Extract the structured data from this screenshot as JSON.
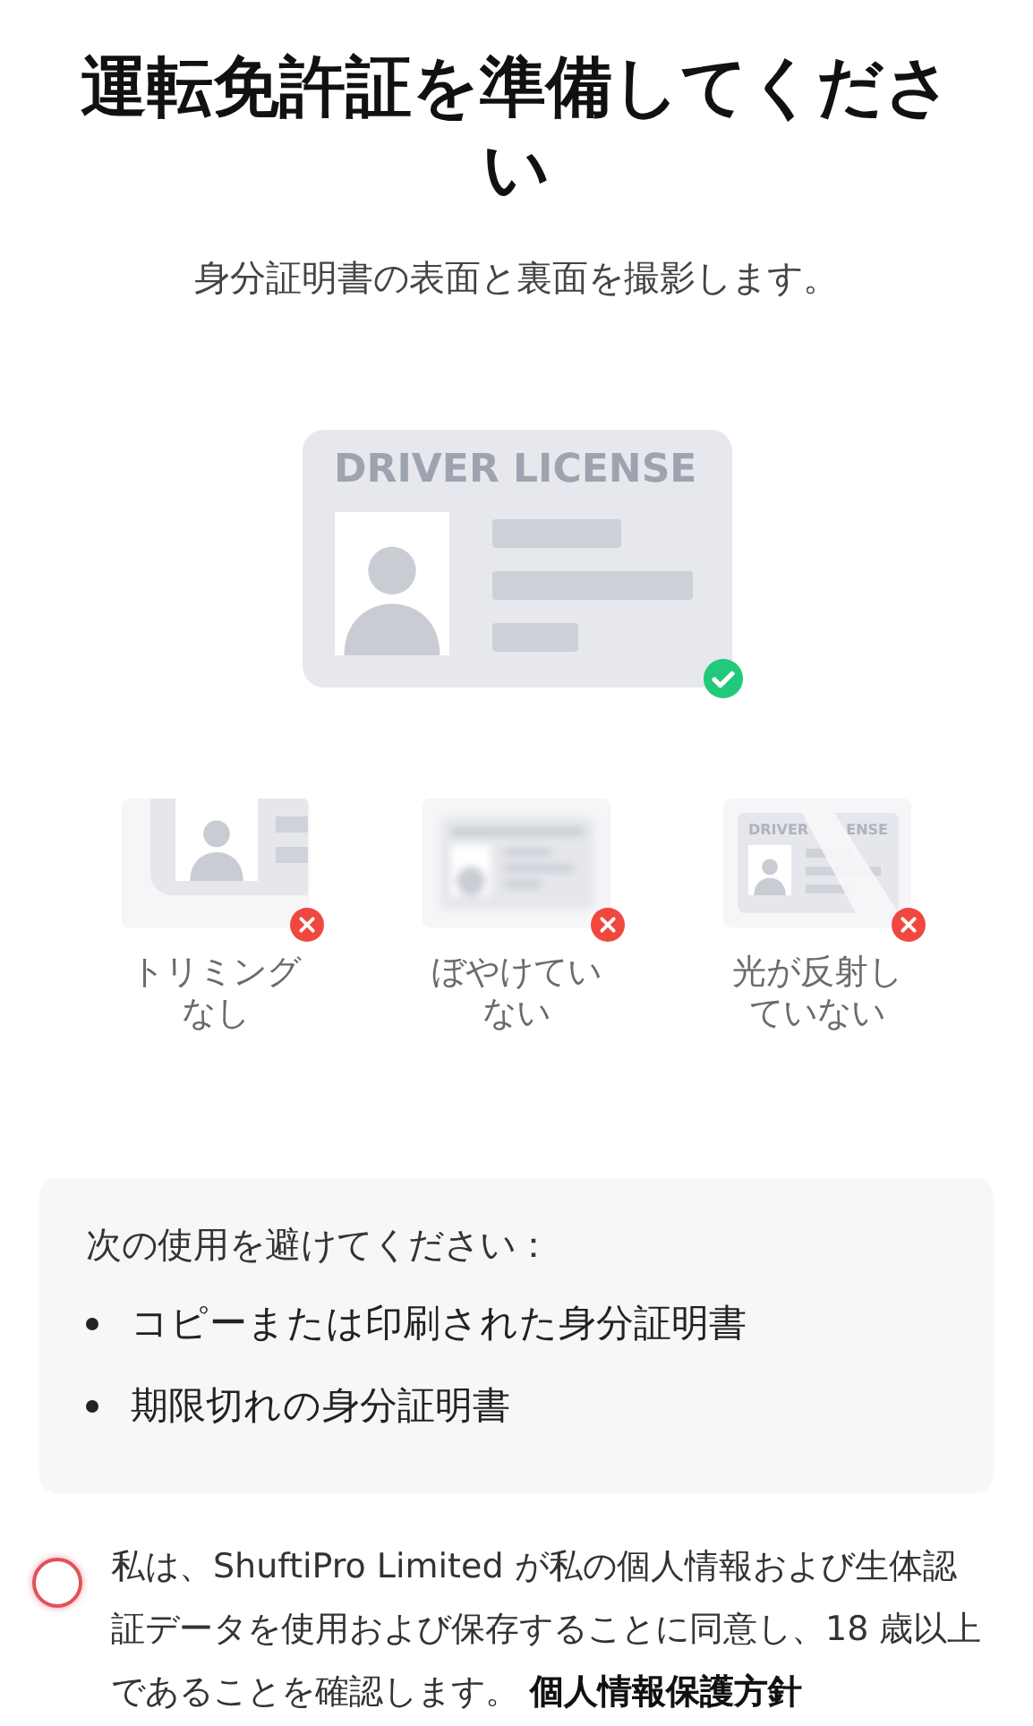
{
  "title": "運転免許証を準備してください",
  "subtitle": "身分証明書の表面と裏面を撮影します。",
  "example_card": {
    "card_title": "DRIVER LICENSE",
    "acceptable": true
  },
  "tips": [
    {
      "kind": "cropped",
      "acceptable": false,
      "label": "トリミングなし"
    },
    {
      "kind": "blurry",
      "acceptable": false,
      "label": "ぼやけていない"
    },
    {
      "kind": "glare",
      "acceptable": false,
      "label": "光が反射していない",
      "card_title_visible": [
        "DRIVER",
        "ENSE"
      ]
    }
  ],
  "avoid": {
    "heading": "次の使用を避けてください：",
    "items": [
      "コピーまたは印刷された身分証明書",
      "期限切れの身分証明書"
    ]
  },
  "consent": {
    "checked": false,
    "text": "私は、ShuftiPro Limited が私の個人情報および生体認証データを使用および保存することに同意し、18 歳以上であることを確認します。",
    "link": "個人情報保護方針"
  }
}
